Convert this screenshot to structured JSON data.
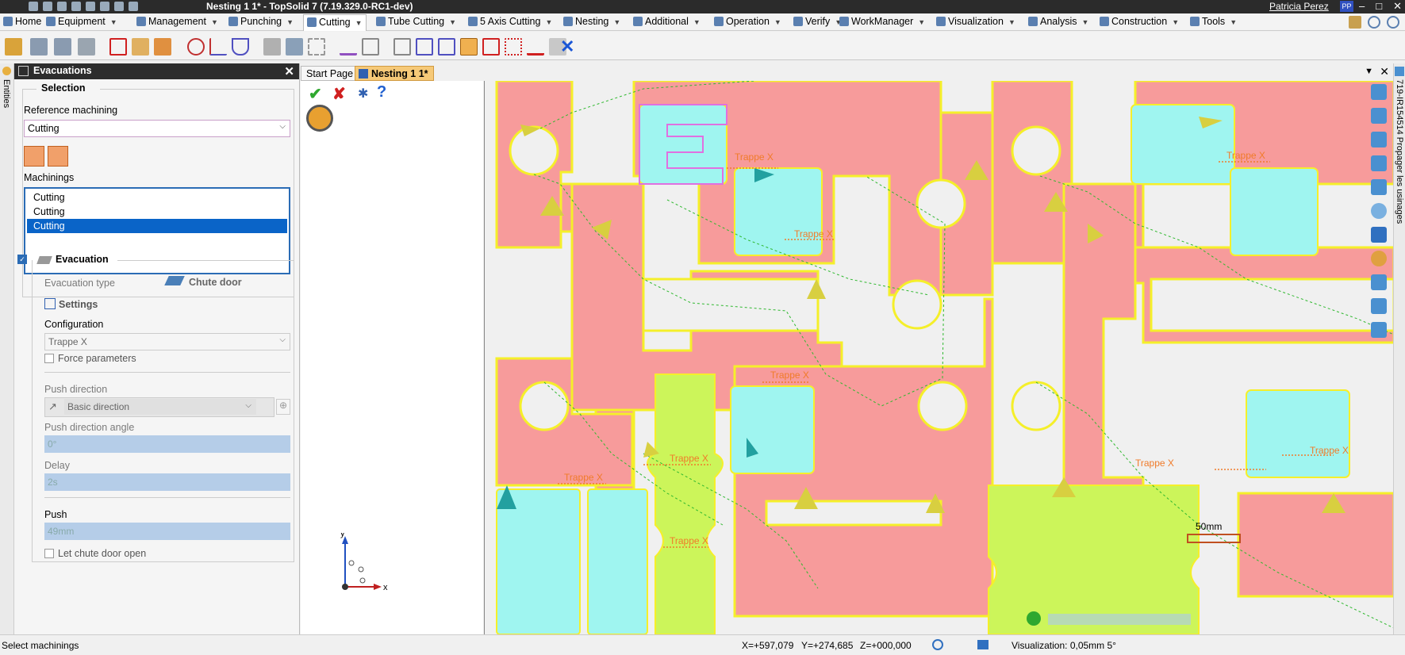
{
  "window": {
    "title": "Nesting 1 1* - TopSolid 7 (7.19.329.0-RC1-dev)",
    "user": "Patricia Perez",
    "avatar": "PP"
  },
  "menu": [
    {
      "label": "Home",
      "icon": "home-icon"
    },
    {
      "label": "Equipment",
      "icon": "equipment-icon"
    },
    {
      "label": "Management",
      "icon": "management-icon"
    },
    {
      "label": "Punching",
      "icon": "punching-icon"
    },
    {
      "label": "Cutting",
      "icon": "cutting-icon",
      "active": true
    },
    {
      "label": "Tube Cutting",
      "icon": "tube-cutting-icon"
    },
    {
      "label": "5 Axis Cutting",
      "icon": "five-axis-icon"
    },
    {
      "label": "Nesting",
      "icon": "nesting-icon"
    },
    {
      "label": "Additional",
      "icon": "additional-icon"
    },
    {
      "label": "Operation",
      "icon": "operation-icon"
    },
    {
      "label": "Verify",
      "icon": "verify-icon"
    },
    {
      "label": "WorkManager",
      "icon": "workmanager-icon"
    },
    {
      "label": "Visualization",
      "icon": "visualization-icon"
    },
    {
      "label": "Analysis",
      "icon": "analysis-icon"
    },
    {
      "label": "Construction",
      "icon": "construction-icon"
    },
    {
      "label": "Tools",
      "icon": "tools-icon"
    }
  ],
  "panel": {
    "title": "Evacuations",
    "selection_group": "Selection",
    "reference_label": "Reference machining",
    "reference_value": "Cutting",
    "machinings_label": "Machinings",
    "machinings": [
      "Cutting",
      "Cutting",
      "Cutting"
    ],
    "evacuation_group": "Evacuation",
    "evacuation_type_label": "Evacuation type",
    "evacuation_type_value": "Chute door",
    "settings_label": "Settings",
    "configuration_label": "Configuration",
    "configuration_value": "Trappe X",
    "force_parameters_label": "Force parameters",
    "push_direction_label": "Push direction",
    "push_direction_value": "Basic direction",
    "push_angle_label": "Push direction angle",
    "push_angle_value": "0°",
    "delay_label": "Delay",
    "delay_value": "2s",
    "push_label": "Push",
    "push_value": "49mm",
    "let_open_label": "Let chute door open"
  },
  "tabs": {
    "start": "Start Page",
    "doc": "Nesting 1 1*"
  },
  "viewport": {
    "label": "Trappe X",
    "scale_label": "50mm",
    "axis_x": "x",
    "axis_y": "y"
  },
  "right_strip": "719-IR154514 Propager les usinages",
  "left_strip": "Entities",
  "status": {
    "message": "Select machinings",
    "x": "X=+597,079",
    "y": "Y=+274,685",
    "z": "Z=+000,000",
    "visualization": "Visualization: 0,05mm 5°"
  },
  "colors": {
    "part_fill": "#f79b9b",
    "contour": "#f5ef2a",
    "accent_selected": "#0a64c8",
    "panel_header": "#2d2d2d"
  }
}
